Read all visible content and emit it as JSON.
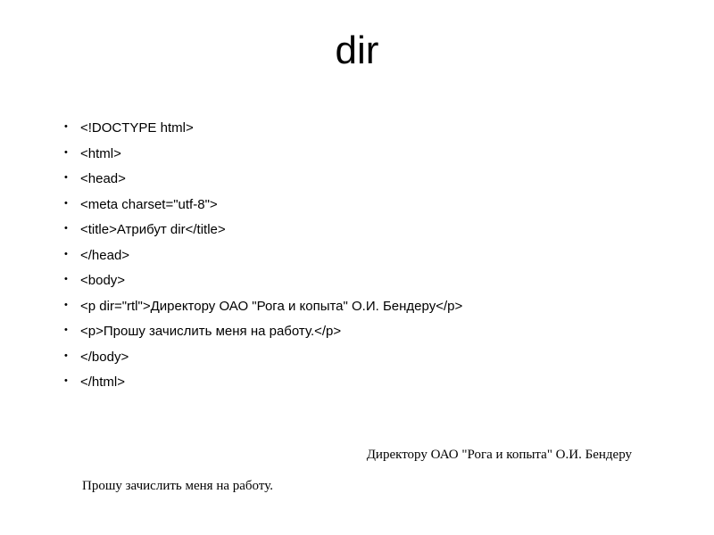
{
  "title": "dir",
  "code": {
    "lines": [
      "<!DOCTYPE html>",
      "<html>",
      " <head>",
      "  <meta charset=\"utf-8\">",
      "  <title>Атрибут dir</title>",
      " </head>",
      " <body>",
      "  <p dir=\"rtl\">Директору ОАО \"Рога и копыта\" О.И. Бендеру</p>",
      "  <p>Прошу зачислить меня на работу.</p>",
      " </body>",
      "</html>"
    ]
  },
  "output": {
    "rtl_line": "Директору ОАО \"Рога и копыта\" О.И. Бендеру",
    "ltr_line": "Прошу зачислить меня на работу."
  }
}
